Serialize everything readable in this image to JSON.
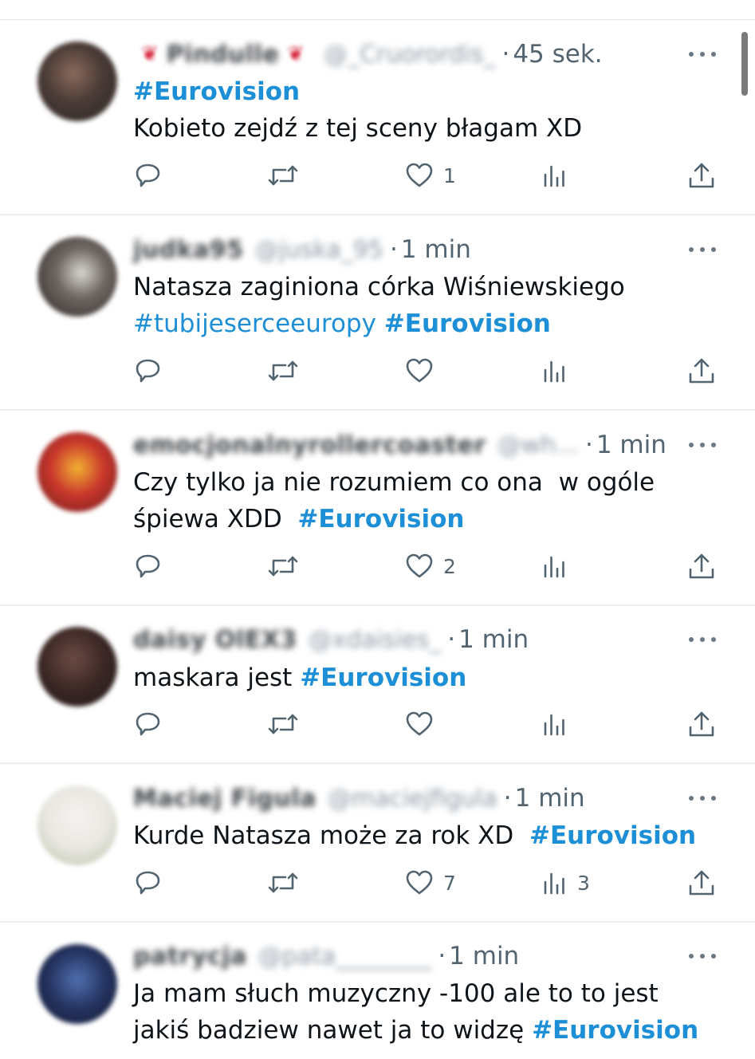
{
  "tweets": [
    {
      "author_name": "Pindulle",
      "author_handle": "@_Cruorordis_",
      "time": "45 sek.",
      "lines": [
        [
          {
            "t": "#Eurovision",
            "s": "tag"
          }
        ],
        [
          {
            "t": "Kobieto zejdź z tej sceny błagam XD",
            "s": "plain"
          }
        ]
      ],
      "likes": "1",
      "views": ""
    },
    {
      "author_name": "judka95",
      "author_handle": "@juska_95",
      "time": "1 min",
      "lines": [
        [
          {
            "t": "Natasza zaginiona córka Wiśniewskiego",
            "s": "plain"
          }
        ],
        [
          {
            "t": "#tubijeserceeuropy",
            "s": "tag-light"
          },
          {
            "t": " ",
            "s": "plain"
          },
          {
            "t": "#Eurovision",
            "s": "tag"
          }
        ]
      ],
      "likes": "",
      "views": ""
    },
    {
      "author_name": "emocjonalnyrollercoaster",
      "author_handle": "@wh...",
      "time": "1 min",
      "lines": [
        [
          {
            "t": "Czy tylko ja nie rozumiem co ona  w ogóle",
            "s": "plain"
          }
        ],
        [
          {
            "t": "śpiewa XDD  ",
            "s": "plain"
          },
          {
            "t": "#Eurovision",
            "s": "tag"
          }
        ]
      ],
      "likes": "2",
      "views": ""
    },
    {
      "author_name": "daisy OlEX3",
      "author_handle": "@xdaisies_",
      "time": "1 min",
      "lines": [
        [
          {
            "t": "maskara jest ",
            "s": "plain"
          },
          {
            "t": "#Eurovision",
            "s": "tag"
          }
        ]
      ],
      "likes": "",
      "views": ""
    },
    {
      "author_name": "Maciej Figula",
      "author_handle": "@maciejfigula",
      "time": "1 min",
      "lines": [
        [
          {
            "t": "Kurde Natasza może za rok XD  ",
            "s": "plain"
          },
          {
            "t": "#Eurovision",
            "s": "tag"
          }
        ]
      ],
      "likes": "7",
      "views": "3"
    },
    {
      "author_name": "patrycja",
      "author_handle": "@pata________",
      "time": "1 min",
      "lines": [
        [
          {
            "t": "Ja mam słuch muzyczny -100 ale to to jest",
            "s": "plain"
          }
        ],
        [
          {
            "t": "jakiś badziew nawet ja to widzę ",
            "s": "plain"
          },
          {
            "t": "#Eurovision",
            "s": "tag"
          }
        ]
      ],
      "likes": "",
      "views": ""
    }
  ],
  "icons": {
    "reply": "reply-icon",
    "retweet": "retweet-icon",
    "like": "heart-icon",
    "views": "views-icon",
    "share": "share-icon",
    "more": "more-icon",
    "cherry": "cherry-icon"
  },
  "time_separator": "·",
  "colors": {
    "hashtag": "#1d8fd6",
    "text": "#0f1419",
    "muted": "#536471",
    "divider": "#eceff1"
  }
}
